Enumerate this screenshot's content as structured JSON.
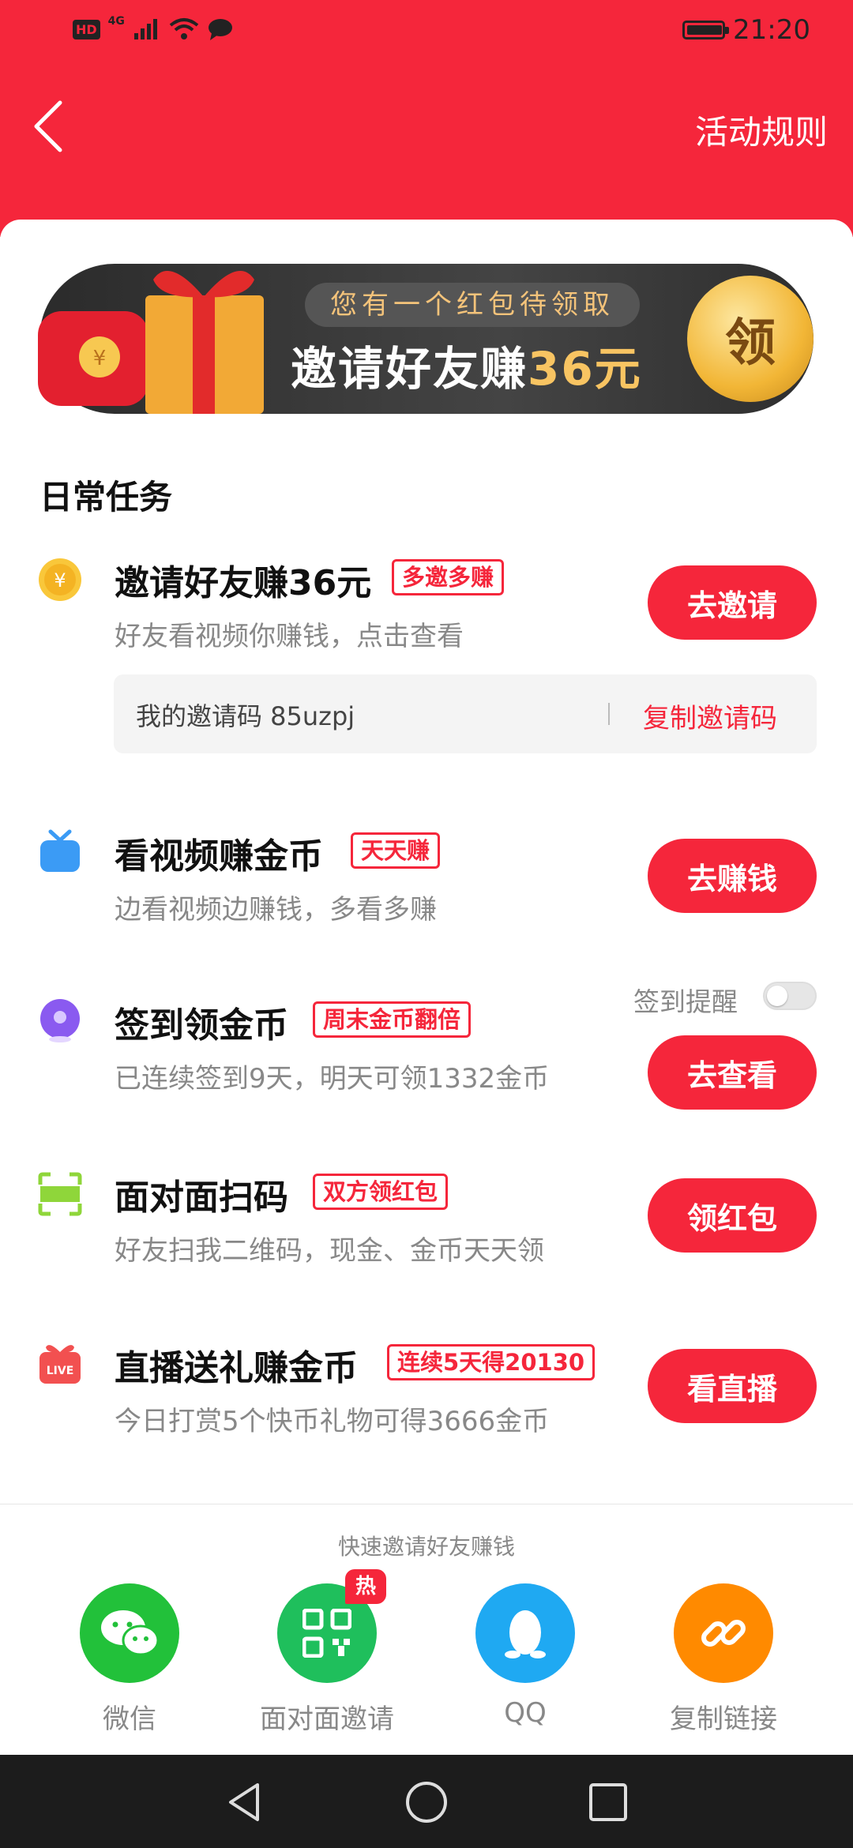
{
  "status_bar": {
    "time": "21:20",
    "network": "4G",
    "hd": "HD"
  },
  "header": {
    "rules_label": "活动规则"
  },
  "banner": {
    "subtitle": "您有一个红包待领取",
    "title_prefix": "邀请好友赚",
    "title_amount": "36元",
    "coin_label": "领"
  },
  "section_title": "日常任务",
  "tasks": [
    {
      "icon": "gold-coin-icon",
      "title": "邀请好友赚36元",
      "tag": "多邀多赚",
      "desc": "好友看视频你赚钱，点击查看",
      "button": "去邀请"
    },
    {
      "icon": "tv-icon",
      "title": "看视频赚金币",
      "tag": "天天赚",
      "desc": "边看视频边赚钱，多看多赚",
      "button": "去赚钱"
    },
    {
      "icon": "location-pin-icon",
      "title": "签到领金币",
      "tag": "周末金币翻倍",
      "desc": "已连续签到9天，明天可领1332金币",
      "button": "去查看"
    },
    {
      "icon": "scan-icon",
      "title": "面对面扫码",
      "tag": "双方领红包",
      "desc": "好友扫我二维码，现金、金币天天领",
      "button": "领红包"
    },
    {
      "icon": "live-gift-icon",
      "title": "直播送礼赚金币",
      "tag": "连续5天得20130",
      "desc": "今日打赏5个快币礼物可得3666金币",
      "button": "看直播"
    }
  ],
  "invite_code": {
    "text": "我的邀请码 85uzpj",
    "copy_label": "复制邀请码"
  },
  "checkin_reminder": {
    "label": "签到提醒",
    "enabled": false
  },
  "share": {
    "title": "快速邀请好友赚钱",
    "items": [
      {
        "label": "微信",
        "icon": "wechat-icon",
        "color": "#22c13a"
      },
      {
        "label": "面对面邀请",
        "icon": "qr-code-icon",
        "color": "#1fbf5c",
        "badge": "热"
      },
      {
        "label": "QQ",
        "icon": "qq-penguin-icon",
        "color": "#1fa9f2"
      },
      {
        "label": "复制链接",
        "icon": "link-icon",
        "color": "#ff8a00"
      }
    ]
  }
}
